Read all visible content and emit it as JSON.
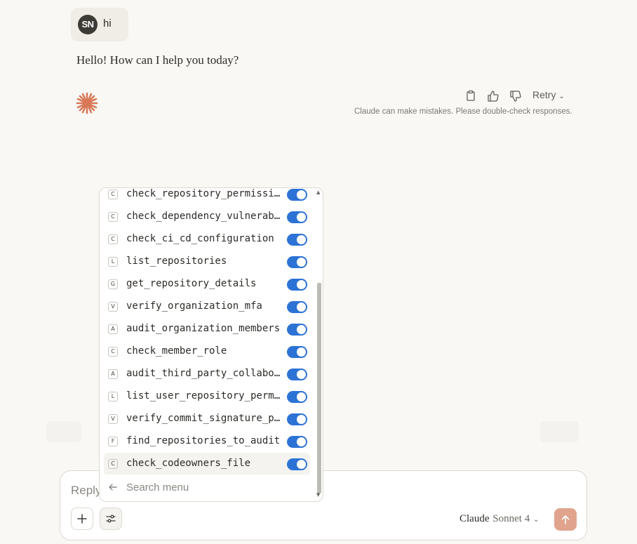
{
  "conversation": {
    "user_avatar_initials": "SN",
    "user_message": "hi",
    "assistant_message": "Hello! How can I help you today?",
    "retry_label": "Retry",
    "disclaimer": "Claude can make mistakes. Please double-check responses."
  },
  "tools_menu": {
    "items": [
      {
        "badge": "C",
        "name": "check_repository_permissions",
        "enabled": true
      },
      {
        "badge": "C",
        "name": "check_dependency_vulnerabi...",
        "enabled": true
      },
      {
        "badge": "C",
        "name": "check_ci_cd_configuration",
        "enabled": true
      },
      {
        "badge": "L",
        "name": "list_repositories",
        "enabled": true
      },
      {
        "badge": "G",
        "name": "get_repository_details",
        "enabled": true
      },
      {
        "badge": "V",
        "name": "verify_organization_mfa",
        "enabled": true
      },
      {
        "badge": "A",
        "name": "audit_organization_members",
        "enabled": true
      },
      {
        "badge": "C",
        "name": "check_member_role",
        "enabled": true
      },
      {
        "badge": "A",
        "name": "audit_third_party_collaborat...",
        "enabled": true
      },
      {
        "badge": "L",
        "name": "list_user_repository_permis...",
        "enabled": true
      },
      {
        "badge": "V",
        "name": "verify_commit_signature_pr...",
        "enabled": true
      },
      {
        "badge": "F",
        "name": "find_repositories_to_audit",
        "enabled": true
      },
      {
        "badge": "C",
        "name": "check_codeowners_file",
        "enabled": true
      }
    ],
    "search_placeholder": "Search menu"
  },
  "composer": {
    "placeholder": "Reply to Claude...",
    "model_name": "Claude",
    "model_version": "Sonnet 4"
  },
  "colors": {
    "toggle_on": "#2d73d6",
    "send_button": "#e0a48e",
    "claude_logo": "#d97757"
  }
}
